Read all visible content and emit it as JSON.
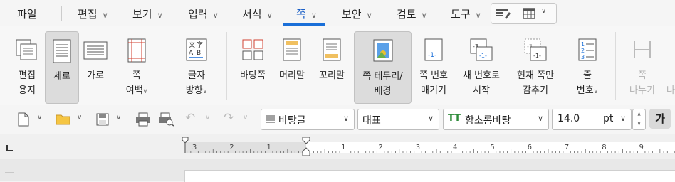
{
  "menu": {
    "items": [
      {
        "label": "파일",
        "chevron": false
      },
      {
        "label": "편집",
        "chevron": true
      },
      {
        "label": "보기",
        "chevron": true
      },
      {
        "label": "입력",
        "chevron": true
      },
      {
        "label": "서식",
        "chevron": true
      },
      {
        "label": "쪽",
        "chevron": true,
        "active": true
      },
      {
        "label": "보안",
        "chevron": true
      },
      {
        "label": "검토",
        "chevron": true
      },
      {
        "label": "도구",
        "chevron": true
      }
    ]
  },
  "ribbon": {
    "edit_paper": {
      "line1": "편집",
      "line2": "용지"
    },
    "portrait": {
      "label": "세로"
    },
    "landscape": {
      "label": "가로"
    },
    "page_margin": {
      "line1": "쪽",
      "line2": "여백"
    },
    "text_direction": {
      "line1": "글자",
      "line2": "방향"
    },
    "page_background": {
      "label": "바탕쪽"
    },
    "header": {
      "label": "머리말"
    },
    "footer": {
      "label": "꼬리말"
    },
    "page_border": {
      "line1": "쪽 테두리/",
      "line2": "배경"
    },
    "page_number": {
      "line1": "쪽 번호",
      "line2": "매기기"
    },
    "new_number": {
      "line1": "새 번호로",
      "line2": "시작"
    },
    "hide_current": {
      "line1": "현재 쪽만",
      "line2": "감추기"
    },
    "line_number": {
      "line1": "줄",
      "line2": "번호"
    },
    "split_page": {
      "line1": "쪽",
      "line2": "나누기"
    },
    "cutoff": {
      "line2": "나"
    }
  },
  "toolbar": {
    "style": "바탕글",
    "lang": "대표",
    "font": "함초롬바탕",
    "font_icon": "TT",
    "size": "14.0",
    "unit": "pt",
    "bold_char": "가"
  },
  "ruler": {
    "left_numbers": [
      "3",
      "2",
      "1"
    ],
    "right_numbers": [
      "1",
      "2",
      "3",
      "4",
      "5",
      "6",
      "7",
      "8",
      "9"
    ]
  },
  "colors": {
    "accent": "#1a6fd8",
    "selected": "#dcdcdc"
  }
}
